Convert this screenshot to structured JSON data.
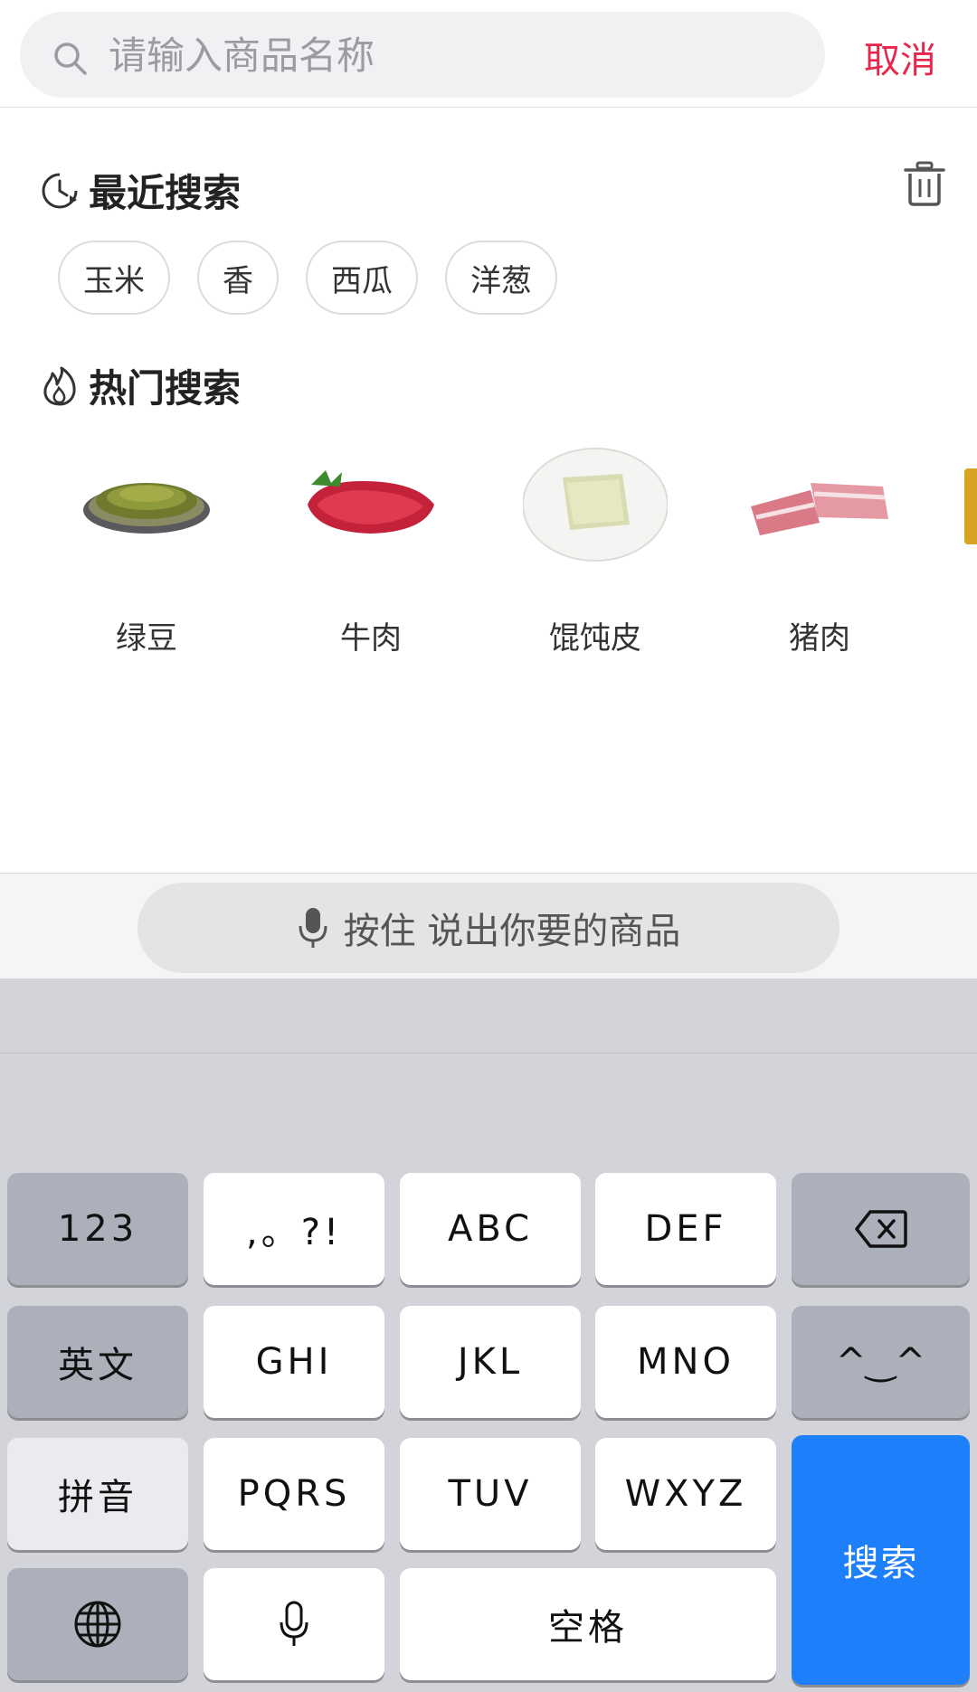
{
  "search": {
    "placeholder": "请输入商品名称",
    "cancel_label": "取消"
  },
  "recent": {
    "title": "最近搜索",
    "items": [
      "玉米",
      "香",
      "西瓜",
      "洋葱"
    ]
  },
  "hot": {
    "title": "热门搜索",
    "items": [
      {
        "label": "绿豆",
        "image": "mung-beans-plate"
      },
      {
        "label": "牛肉",
        "image": "raw-beef"
      },
      {
        "label": "馄饨皮",
        "image": "wonton-wrappers-plate"
      },
      {
        "label": "猪肉",
        "image": "pork-belly"
      }
    ]
  },
  "voice": {
    "label": "按住 说出你要的商品"
  },
  "keyboard": {
    "row1": [
      "123",
      ",。?!",
      "ABC",
      "DEF"
    ],
    "row2": [
      "英文",
      "GHI",
      "JKL",
      "MNO",
      "^‿^"
    ],
    "row3": [
      "拼音",
      "PQRS",
      "TUV",
      "WXYZ"
    ],
    "space_label": "空格",
    "search_label": "搜索"
  },
  "colors": {
    "accent_red": "#e6264a",
    "keyboard_blue": "#1e7ffb"
  }
}
